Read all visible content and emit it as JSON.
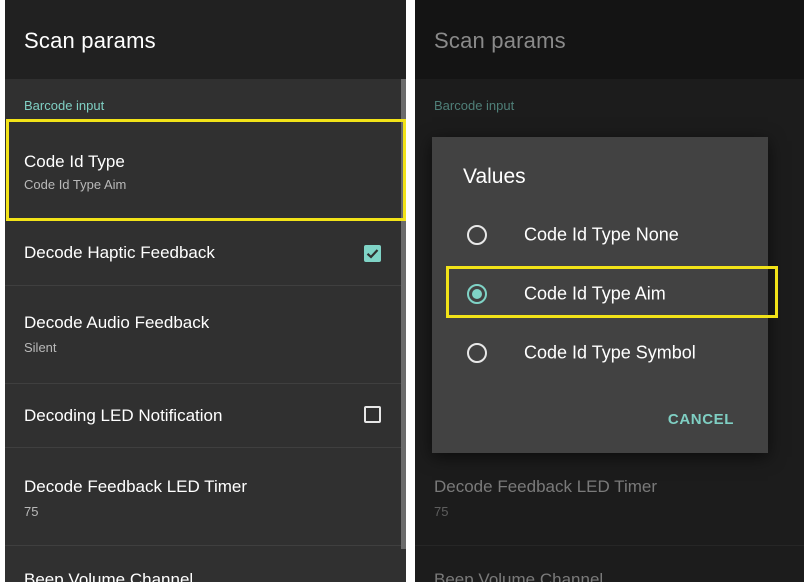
{
  "left": {
    "app_title": "Scan params",
    "section": "Barcode input",
    "prefs": {
      "code_id_type": {
        "title": "Code Id Type",
        "summary": "Code Id Type Aim"
      },
      "haptic": {
        "title": "Decode Haptic Feedback",
        "checked": true
      },
      "audio": {
        "title": "Decode Audio Feedback",
        "summary": "Silent"
      },
      "led": {
        "title": "Decoding LED Notification",
        "checked": false
      },
      "led_timer": {
        "title": "Decode Feedback LED Timer",
        "summary": "75"
      },
      "beep": {
        "title": "Beep Volume Channel"
      }
    }
  },
  "right": {
    "app_title": "Scan params",
    "section": "Barcode input",
    "prefs": {
      "led_timer": {
        "title": "Decode Feedback LED Timer",
        "summary": "75"
      },
      "beep": {
        "title": "Beep Volume Channel"
      }
    },
    "dialog": {
      "title": "Values",
      "options": [
        {
          "label": "Code Id Type None",
          "selected": false
        },
        {
          "label": "Code Id Type Aim",
          "selected": true
        },
        {
          "label": "Code Id Type Symbol",
          "selected": false
        }
      ],
      "cancel_label": "CANCEL"
    }
  },
  "colors": {
    "accent": "#7fd3c6",
    "highlight": "#f2e318",
    "background": "#303030",
    "appbar": "#212121",
    "dialog": "#424242"
  }
}
